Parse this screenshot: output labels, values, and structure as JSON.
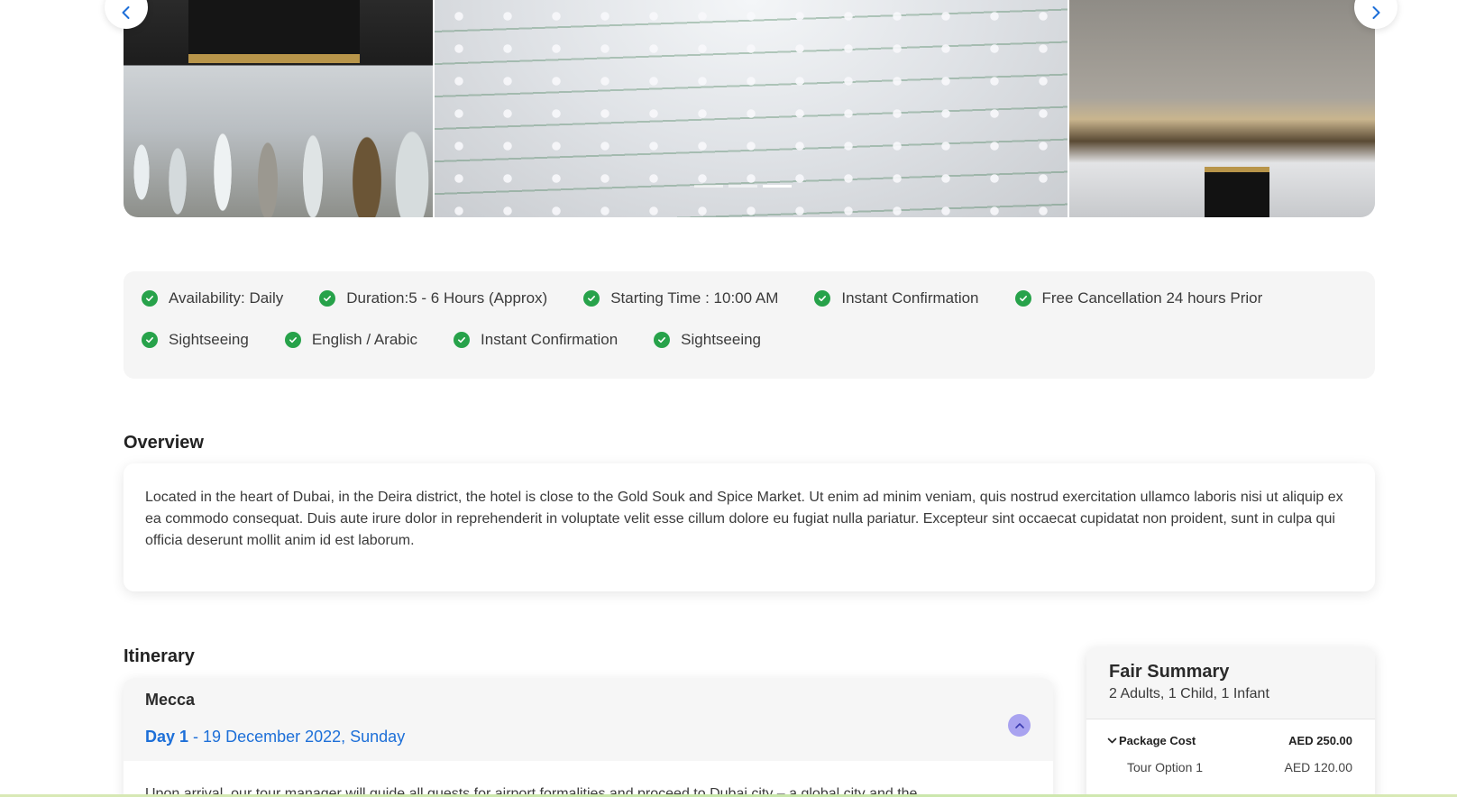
{
  "gallery": {
    "images": [
      "kaaba-pilgrims-photo",
      "prayer-courtyard-photo",
      "clock-tower-photo"
    ],
    "active_slide": 2,
    "slide_count": 3
  },
  "features": [
    "Availability: Daily",
    "Duration:5 - 6 Hours (Approx)",
    "Starting Time : 10:00 AM",
    "Instant Confirmation",
    "Free Cancellation 24 hours Prior",
    "Sightseeing",
    "English / Arabic",
    "Instant Confirmation",
    "Sightseeing"
  ],
  "overview": {
    "title": "Overview",
    "text": "Located in the heart of Dubai, in the Deira district, the hotel is close to the Gold Souk and Spice Market. Ut enim ad minim veniam, quis nostrud exercitation ullamco laboris nisi ut aliquip ex ea commodo consequat. Duis aute irure dolor in reprehenderit in voluptate velit esse cillum dolore eu fugiat nulla pariatur. Excepteur sint occaecat cupidatat non proident, sunt in culpa qui officia deserunt mollit anim id est laborum."
  },
  "itinerary": {
    "title": "Itinerary",
    "city": "Mecca",
    "day_label": "Day 1",
    "day_date": " - 19 December 2022, Sunday",
    "body": "Upon arrival, our tour manager will guide all guests for airport formalities and proceed to Dubai city – a global city and the"
  },
  "summary": {
    "title": "Fair Summary",
    "guests": "2 Adults, 1 Child, 1 Infant",
    "package_label": "Package Cost",
    "package_value": "AED 250.00",
    "option_label": "Tour Option 1",
    "option_value": "AED 120.00"
  },
  "colors": {
    "check": "#27a24a",
    "link_blue": "#1d6fd8",
    "collapse_btn": "#a9a3f0"
  }
}
